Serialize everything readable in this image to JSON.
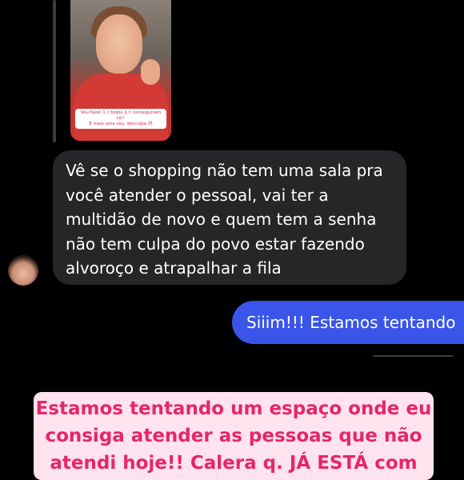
{
  "story_reply": {
    "caption_line1": "Vou fazer 1 c todos q n conseguiram tá!!",
    "caption_line2": "E mais uma vez, desculpa 😓"
  },
  "incoming_message": {
    "lines": [
      "Vê se o shopping não tem uma sala pra",
      "você atender o pessoal, vai ter a",
      "multidão de novo e quem tem a senha",
      "não tem culpa do povo estar fazendo",
      "alvoroço e atrapalhar a fila"
    ]
  },
  "outgoing_message": {
    "text": "Siiim!!! Estamos tentando"
  },
  "overlay_text": {
    "lines": [
      "Estamos tentando um espaço onde eu",
      "consiga atender as pessoas que não",
      "atendi hoje!! Calera q. JÁ ESTÁ com"
    ]
  },
  "colors": {
    "background": "#000000",
    "incoming_bubble": "#262628",
    "outgoing_bubble": "#3a55e8",
    "overlay_bg": "#ffe3ee",
    "overlay_text": "#e6266a"
  }
}
